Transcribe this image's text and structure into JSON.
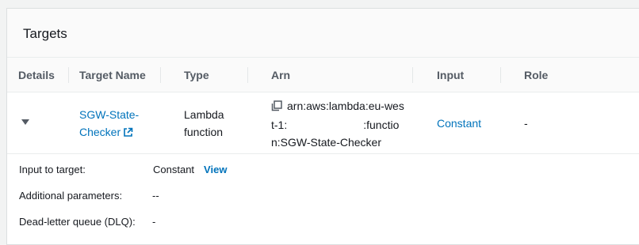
{
  "panel": {
    "title": "Targets"
  },
  "table": {
    "headers": {
      "details": "Details",
      "target_name": "Target Name",
      "type": "Type",
      "arn": "Arn",
      "input": "Input",
      "role": "Role"
    },
    "row": {
      "name_line1": "SGW-State-",
      "name_line2": "Checker",
      "type_line1": "Lambda",
      "type_line2": "function",
      "arn_line1": "arn:aws:lambda:eu-wes",
      "arn_line2a": "t-1:",
      "arn_line2b": ":functio",
      "arn_line3": "n:SGW-State-Checker",
      "input": "Constant",
      "role": "-"
    }
  },
  "details": {
    "input_label": "Input to target:",
    "input_value": "Constant",
    "view_label": "View",
    "params_label": "Additional parameters:",
    "params_value": "--",
    "dlq_label": "Dead-letter queue (DLQ):",
    "dlq_value": "-"
  },
  "colors": {
    "link": "#0073bb",
    "header_text": "#545b64"
  },
  "icons": {
    "expand": "caret-down-icon",
    "external": "external-link-icon",
    "copy": "copy-icon"
  }
}
